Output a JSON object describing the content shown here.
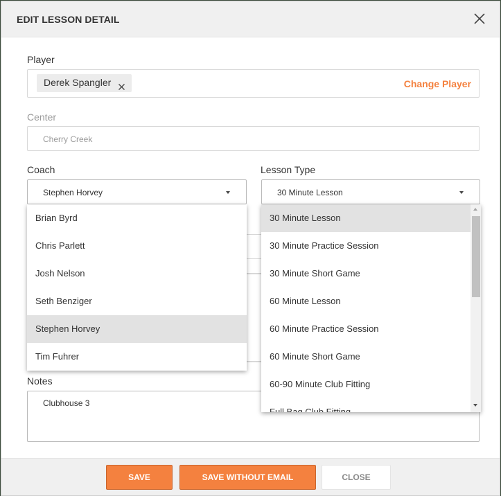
{
  "header": {
    "title": "EDIT LESSON DETAIL",
    "close_icon": "close-icon"
  },
  "player": {
    "label": "Player",
    "chip": "Derek Spangler",
    "change_label": "Change Player"
  },
  "center": {
    "label": "Center",
    "value": "Cherry Creek"
  },
  "coach": {
    "label": "Coach",
    "value": "Stephen Horvey",
    "options": [
      "Brian Byrd",
      "Chris Parlett",
      "Josh Nelson",
      "Seth Benziger",
      "Stephen Horvey",
      "Tim Fuhrer"
    ]
  },
  "lesson_type": {
    "label": "Lesson Type",
    "value": "30 Minute Lesson",
    "options": [
      "30 Minute Lesson",
      "30 Minute Practice Session",
      "30 Minute Short Game",
      "60 Minute Lesson",
      "60 Minute Practice Session",
      "60 Minute Short Game",
      "60-90 Minute Club Fitting",
      "Full Bag Club Fitting"
    ]
  },
  "notes": {
    "label": "Notes",
    "value": "Clubhouse 3"
  },
  "footer": {
    "save": "SAVE",
    "save_without_email": "SAVE WITHOUT EMAIL",
    "close": "CLOSE"
  },
  "colors": {
    "accent": "#f4813f",
    "selected_row": "#e2e2e2",
    "header_bg": "#f0f0f0"
  }
}
